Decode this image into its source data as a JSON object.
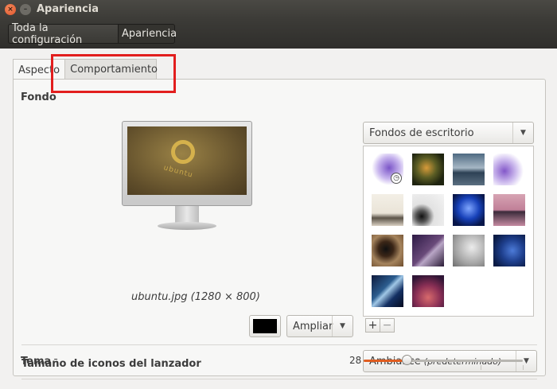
{
  "window": {
    "title": "Apariencia",
    "close_glyph": "×",
    "min_glyph": "–"
  },
  "toolbar": {
    "all_settings": "Toda la configuración",
    "current": "Apariencia"
  },
  "tabs": [
    {
      "label": "Aspecto",
      "active": true
    },
    {
      "label": "Comportamiento",
      "active": false
    }
  ],
  "background": {
    "label": "Fondo",
    "preview_logo_text": "ubuntu",
    "wallpaper_name": "ubuntu.jpg (1280 × 800)",
    "source": "Fondos de escritorio",
    "color": "#000000",
    "mode": "Ampliar",
    "thumbnails": [
      {
        "name": "lilac-flower",
        "selected": true
      },
      {
        "name": "mushroom"
      },
      {
        "name": "stormy-sea"
      },
      {
        "name": "lilac-flower-2"
      },
      {
        "name": "foggy-landscape"
      },
      {
        "name": "gray-abstract"
      },
      {
        "name": "blue-jellyfish"
      },
      {
        "name": "pink-lake"
      },
      {
        "name": "tunnel"
      },
      {
        "name": "purple-stairs"
      },
      {
        "name": "gray-bird"
      },
      {
        "name": "blue-bokeh"
      },
      {
        "name": "galaxy"
      },
      {
        "name": "red-nebula"
      }
    ],
    "add_glyph": "+",
    "remove_glyph": "−",
    "arrow_glyph": "▼"
  },
  "theme": {
    "label": "Tema",
    "value": "Ambiance",
    "value_note": "(predeterminado)"
  },
  "launcher": {
    "label": "Tamaño de iconos del lanzador",
    "value": "28",
    "level": 0.27
  },
  "colors": {
    "accent": "#e05d20",
    "highlight": "#e21e1e"
  }
}
